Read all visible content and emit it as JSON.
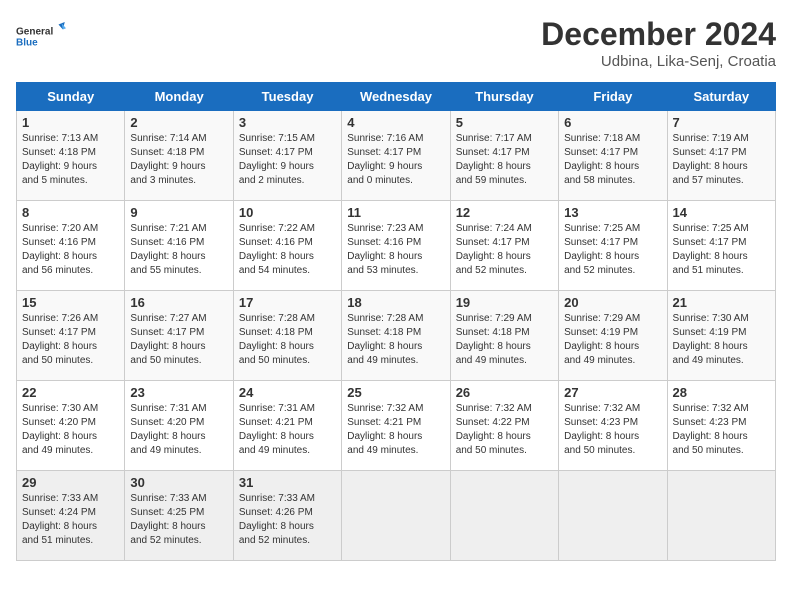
{
  "logo": {
    "line1": "General",
    "line2": "Blue"
  },
  "title": "December 2024",
  "subtitle": "Udbina, Lika-Senj, Croatia",
  "headers": [
    "Sunday",
    "Monday",
    "Tuesday",
    "Wednesday",
    "Thursday",
    "Friday",
    "Saturday"
  ],
  "weeks": [
    [
      {
        "day": "1",
        "info": "Sunrise: 7:13 AM\nSunset: 4:18 PM\nDaylight: 9 hours\nand 5 minutes."
      },
      {
        "day": "2",
        "info": "Sunrise: 7:14 AM\nSunset: 4:18 PM\nDaylight: 9 hours\nand 3 minutes."
      },
      {
        "day": "3",
        "info": "Sunrise: 7:15 AM\nSunset: 4:17 PM\nDaylight: 9 hours\nand 2 minutes."
      },
      {
        "day": "4",
        "info": "Sunrise: 7:16 AM\nSunset: 4:17 PM\nDaylight: 9 hours\nand 0 minutes."
      },
      {
        "day": "5",
        "info": "Sunrise: 7:17 AM\nSunset: 4:17 PM\nDaylight: 8 hours\nand 59 minutes."
      },
      {
        "day": "6",
        "info": "Sunrise: 7:18 AM\nSunset: 4:17 PM\nDaylight: 8 hours\nand 58 minutes."
      },
      {
        "day": "7",
        "info": "Sunrise: 7:19 AM\nSunset: 4:17 PM\nDaylight: 8 hours\nand 57 minutes."
      }
    ],
    [
      {
        "day": "8",
        "info": "Sunrise: 7:20 AM\nSunset: 4:16 PM\nDaylight: 8 hours\nand 56 minutes."
      },
      {
        "day": "9",
        "info": "Sunrise: 7:21 AM\nSunset: 4:16 PM\nDaylight: 8 hours\nand 55 minutes."
      },
      {
        "day": "10",
        "info": "Sunrise: 7:22 AM\nSunset: 4:16 PM\nDaylight: 8 hours\nand 54 minutes."
      },
      {
        "day": "11",
        "info": "Sunrise: 7:23 AM\nSunset: 4:16 PM\nDaylight: 8 hours\nand 53 minutes."
      },
      {
        "day": "12",
        "info": "Sunrise: 7:24 AM\nSunset: 4:17 PM\nDaylight: 8 hours\nand 52 minutes."
      },
      {
        "day": "13",
        "info": "Sunrise: 7:25 AM\nSunset: 4:17 PM\nDaylight: 8 hours\nand 52 minutes."
      },
      {
        "day": "14",
        "info": "Sunrise: 7:25 AM\nSunset: 4:17 PM\nDaylight: 8 hours\nand 51 minutes."
      }
    ],
    [
      {
        "day": "15",
        "info": "Sunrise: 7:26 AM\nSunset: 4:17 PM\nDaylight: 8 hours\nand 50 minutes."
      },
      {
        "day": "16",
        "info": "Sunrise: 7:27 AM\nSunset: 4:17 PM\nDaylight: 8 hours\nand 50 minutes."
      },
      {
        "day": "17",
        "info": "Sunrise: 7:28 AM\nSunset: 4:18 PM\nDaylight: 8 hours\nand 50 minutes."
      },
      {
        "day": "18",
        "info": "Sunrise: 7:28 AM\nSunset: 4:18 PM\nDaylight: 8 hours\nand 49 minutes."
      },
      {
        "day": "19",
        "info": "Sunrise: 7:29 AM\nSunset: 4:18 PM\nDaylight: 8 hours\nand 49 minutes."
      },
      {
        "day": "20",
        "info": "Sunrise: 7:29 AM\nSunset: 4:19 PM\nDaylight: 8 hours\nand 49 minutes."
      },
      {
        "day": "21",
        "info": "Sunrise: 7:30 AM\nSunset: 4:19 PM\nDaylight: 8 hours\nand 49 minutes."
      }
    ],
    [
      {
        "day": "22",
        "info": "Sunrise: 7:30 AM\nSunset: 4:20 PM\nDaylight: 8 hours\nand 49 minutes."
      },
      {
        "day": "23",
        "info": "Sunrise: 7:31 AM\nSunset: 4:20 PM\nDaylight: 8 hours\nand 49 minutes."
      },
      {
        "day": "24",
        "info": "Sunrise: 7:31 AM\nSunset: 4:21 PM\nDaylight: 8 hours\nand 49 minutes."
      },
      {
        "day": "25",
        "info": "Sunrise: 7:32 AM\nSunset: 4:21 PM\nDaylight: 8 hours\nand 49 minutes."
      },
      {
        "day": "26",
        "info": "Sunrise: 7:32 AM\nSunset: 4:22 PM\nDaylight: 8 hours\nand 50 minutes."
      },
      {
        "day": "27",
        "info": "Sunrise: 7:32 AM\nSunset: 4:23 PM\nDaylight: 8 hours\nand 50 minutes."
      },
      {
        "day": "28",
        "info": "Sunrise: 7:32 AM\nSunset: 4:23 PM\nDaylight: 8 hours\nand 50 minutes."
      }
    ],
    [
      {
        "day": "29",
        "info": "Sunrise: 7:33 AM\nSunset: 4:24 PM\nDaylight: 8 hours\nand 51 minutes."
      },
      {
        "day": "30",
        "info": "Sunrise: 7:33 AM\nSunset: 4:25 PM\nDaylight: 8 hours\nand 52 minutes."
      },
      {
        "day": "31",
        "info": "Sunrise: 7:33 AM\nSunset: 4:26 PM\nDaylight: 8 hours\nand 52 minutes."
      },
      {
        "day": "",
        "info": ""
      },
      {
        "day": "",
        "info": ""
      },
      {
        "day": "",
        "info": ""
      },
      {
        "day": "",
        "info": ""
      }
    ]
  ]
}
